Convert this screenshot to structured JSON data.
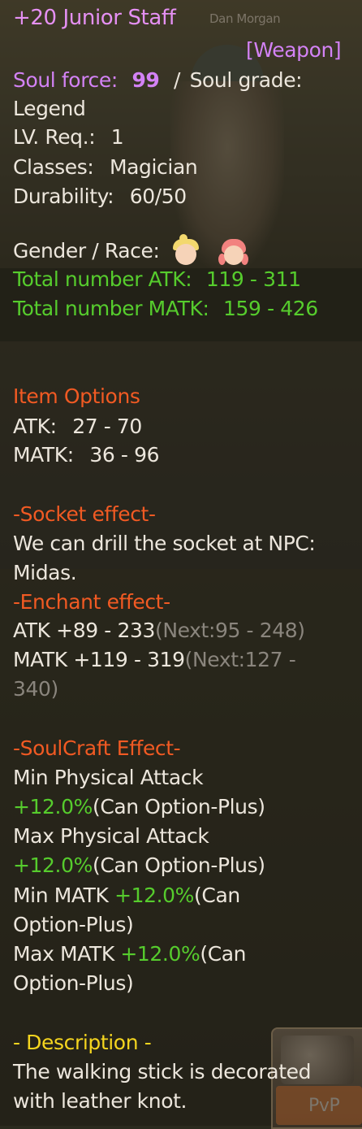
{
  "background": {
    "npc_name": "Dan Morgan"
  },
  "item": {
    "name": "+20 Junior Staff",
    "type": "[Weapon]",
    "soul_force_label": "Soul force:",
    "soul_force_value": "99",
    "separator": "/",
    "soul_grade_label": "Soul grade:",
    "soul_grade_value": "Legend",
    "lv_req_label": "LV. Req.:",
    "lv_req_value": "1",
    "classes_label": "Classes:",
    "classes_value": "Magician",
    "durability_label": "Durability:",
    "durability_value": "60/50",
    "gender_race_label": "Gender / Race:",
    "gender_race_icons": [
      "male-character-icon",
      "female-character-icon"
    ],
    "total_atk_label": "Total number ATK:",
    "total_atk_value": "119 - 311",
    "total_matk_label": "Total number MATK:",
    "total_matk_value": "159 - 426"
  },
  "item_options": {
    "header": "Item Options",
    "atk_label": "ATK:",
    "atk_value": "27 - 70",
    "matk_label": "MATK:",
    "matk_value": "36 - 96"
  },
  "socket": {
    "header": "-Socket effect-",
    "line1": "We can drill the socket at NPC:",
    "line2": "Midas."
  },
  "enchant": {
    "header": "-Enchant effect-",
    "atk_text": "ATK +89 - 233",
    "atk_next": "(Next:95 - 248)",
    "matk_text": "MATK +119 - 319",
    "matk_next_1": "(Next:127 -",
    "matk_next_2": "340)"
  },
  "soulcraft": {
    "header": "-SoulCraft Effect-",
    "effects": [
      {
        "name": "Min Physical Attack",
        "bonus": "+12.0%",
        "note": "(Can Option-Plus)"
      },
      {
        "name": "Max Physical Attack",
        "bonus": "+12.0%",
        "note": "(Can Option-Plus)"
      },
      {
        "name": "Min MATK",
        "bonus": "+12.0%",
        "note_1": "(Can",
        "note_2": "Option-Plus)"
      },
      {
        "name": "Max MATK",
        "bonus": "+12.0%",
        "note_1": "(Can",
        "note_2": "Option-Plus)"
      }
    ]
  },
  "description": {
    "header": "- Description -",
    "line1": "The walking stick is decorated",
    "line2": "with leather knot."
  },
  "pvp_button": {
    "label": "PvP"
  },
  "colors": {
    "title": "#e590f3",
    "green_stat": "#56cc2d",
    "section_header": "#f15a23",
    "description_header": "#f5d51f",
    "next_value": "#8a857d"
  }
}
